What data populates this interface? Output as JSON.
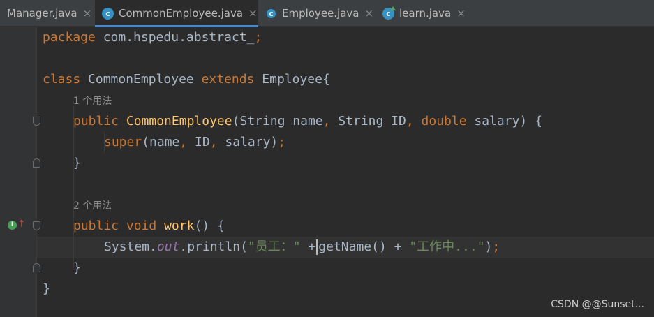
{
  "tabs": [
    {
      "label": "Manager.java",
      "icon": "class-icon",
      "active": false
    },
    {
      "label": "CommonEmployee.java",
      "icon": "class-icon",
      "active": true
    },
    {
      "label": "Employee.java",
      "icon": "abstract-class-icon",
      "active": false
    },
    {
      "label": "learn.java",
      "icon": "runnable-class-icon",
      "active": false
    }
  ],
  "tab_close_glyph": "×",
  "code": {
    "l1_kw": "package",
    "l1_rest": " com.hspedu.abstract_",
    "l1_semi": ";",
    "l3_kw1": "class",
    "l3_name": " CommonEmployee ",
    "l3_kw2": "extends",
    "l3_rest": " Employee{",
    "hint1": "1 个用法",
    "l5_kw": "public",
    "l5_fn": "CommonEmployee",
    "l5_p1": "(String name",
    "l5_c1": ",",
    "l5_p2": " String ID",
    "l5_c2": ",",
    "l5_kw2": "double",
    "l5_p3": " salary) {",
    "l6_kw": "super",
    "l6_p1": "(name",
    "l6_c1": ",",
    "l6_p2": " ID",
    "l6_c2": ",",
    "l6_p3": " salary)",
    "l6_semi": ";",
    "l7_close": "}",
    "hint2": "2 个用法",
    "l9_kw1": "public",
    "l9_kw2": "void",
    "l9_fn": "work",
    "l9_rest": "() {",
    "l10_a": "System.",
    "l10_field": "out",
    "l10_b": ".println(",
    "l10_str1": "\"员工：\"",
    "l10_plus": " +",
    "l10_c": "getName() + ",
    "l10_str2": "\"工作中...\"",
    "l10_d": ")",
    "l10_semi": ";",
    "l11_close": "}",
    "l12_close": "}"
  },
  "watermark": "CSDN @@Sunset...",
  "colors": {
    "background": "#2b2b2b",
    "keyword": "#cc7832",
    "function": "#ffc66d",
    "string": "#6a8759",
    "static_field": "#9876aa",
    "text": "#a9b7c6",
    "tab_accent": "#4a88c7"
  }
}
